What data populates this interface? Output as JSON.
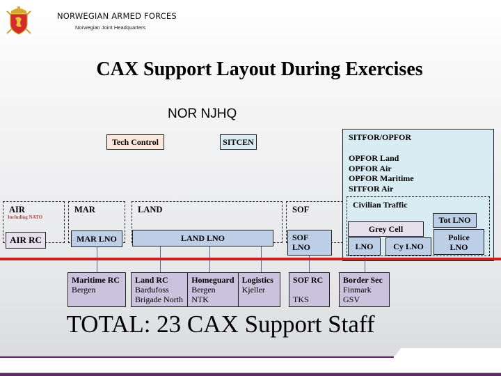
{
  "header": {
    "org_name": "NORWEGIAN ARMED FORCES",
    "org_subtitle": "Norwegian Joint Headquarters",
    "logo_icon": "coat-of-arms-icon"
  },
  "title": "CAX Support Layout During Exercises",
  "hq_label": "NOR NJHQ",
  "top_units": {
    "tech_control": "Tech Control",
    "sitcen": "SITCEN"
  },
  "sitfor": {
    "header": "SITFOR/OPFOR",
    "items": [
      "OPFOR Land",
      "OPFOR Air",
      "OPFOR Maritime",
      "SITFOR Air"
    ],
    "civilian_traffic": {
      "label": "Civilian Traffic",
      "grey_cell": "Grey Cell",
      "lno": "LNO",
      "cy_lno": "Cy LNO",
      "tot_lno": "Tot LNO",
      "police_lno_line1": "Police",
      "police_lno_line2": "LNO"
    }
  },
  "groups": {
    "air": {
      "label": "AIR",
      "note": "Including NATO",
      "unit": "AIR RC"
    },
    "mar": {
      "label": "MAR",
      "unit": "MAR LNO"
    },
    "land": {
      "label": "LAND",
      "unit": "LAND LNO"
    },
    "sof": {
      "label": "SOF",
      "unit_line1": "SOF",
      "unit_line2": "LNO"
    }
  },
  "response_cells": {
    "maritime_rc": {
      "title": "Maritime RC",
      "lines": [
        "Bergen"
      ]
    },
    "land_rc": {
      "title": "Land RC",
      "lines": [
        "Bardufoss",
        "Brigade North"
      ]
    },
    "homeguard": {
      "title": "Homeguard",
      "lines": [
        "Bergen",
        "NTK"
      ]
    },
    "logistics": {
      "title": "Logistics",
      "lines": [
        "Kjeller"
      ]
    },
    "sof_rc": {
      "title": "SOF RC",
      "lines": [
        "",
        "TKS"
      ]
    },
    "border_sec": {
      "title": "Border Sec",
      "lines": [
        "Finmark",
        "GSV"
      ]
    }
  },
  "total": "TOTAL: 23 CAX Support Staff",
  "colors": {
    "divider_red": "#cc1f1f",
    "footer_purple": "#5a2e5e",
    "lno_blue": "#bccfe6",
    "rc_lilac": "#cbc3de",
    "sitfor_blue": "#d9ebf3",
    "tech_peach": "#fbe8dc"
  }
}
